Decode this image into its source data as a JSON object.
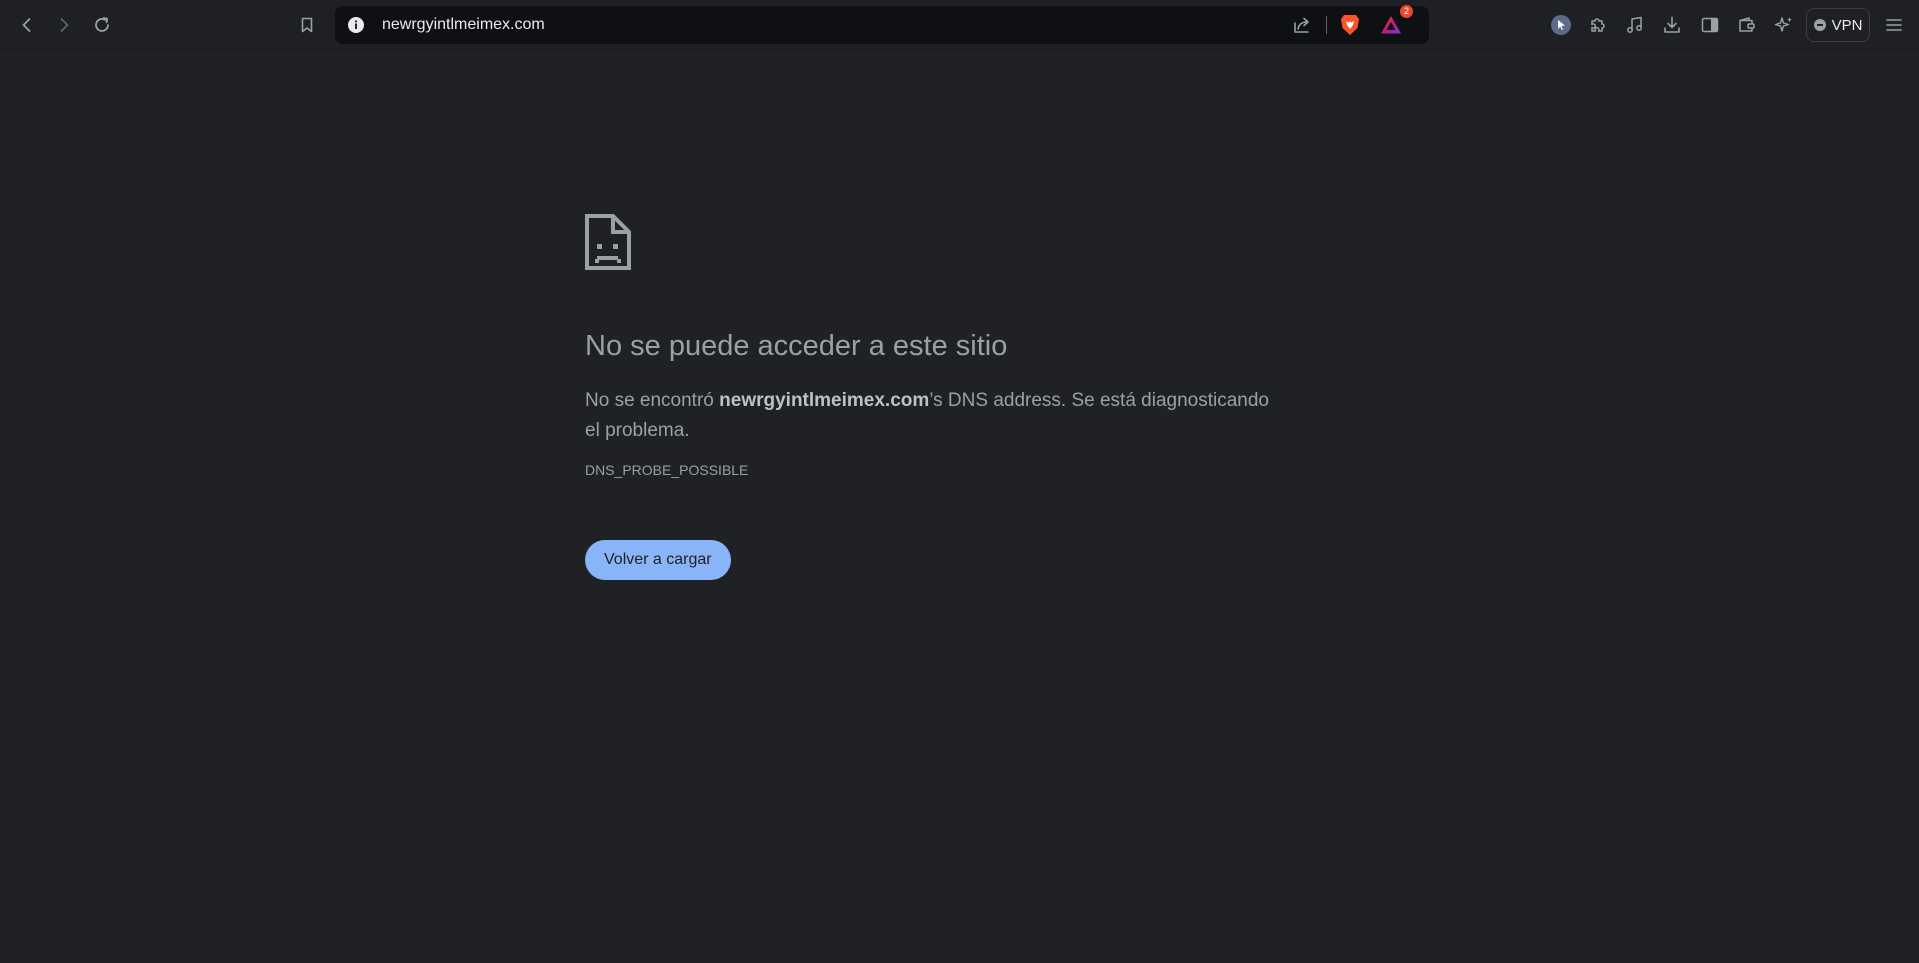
{
  "toolbar": {
    "url": "newrgyintlmeimex.com",
    "notification_count": "2",
    "vpn_label": "VPN"
  },
  "icons": {
    "back": "back-arrow-icon",
    "forward": "forward-arrow-icon",
    "reload": "reload-icon",
    "bookmark": "bookmark-icon",
    "site_info": "info-icon",
    "share": "share-icon",
    "brave_shields": "brave-lion-icon",
    "brave_rewards": "rewards-triangle-icon",
    "cursor": "cursor-icon",
    "extensions": "puzzle-icon",
    "media": "music-note-icon",
    "downloads": "download-icon",
    "sidebar": "sidebar-icon",
    "wallet": "wallet-icon",
    "leo": "sparkle-icon",
    "menu": "hamburger-menu-icon",
    "error_page": "sad-document-icon"
  },
  "error": {
    "title": "No se puede acceder a este sitio",
    "desc_prefix": "No se encontró ",
    "desc_host": "newrgyintlmeimex.com",
    "desc_suffix": "’s DNS address. Se está diagnosticando el problema.",
    "code": "DNS_PROBE_POSSIBLE",
    "reload_button": "Volver a cargar"
  },
  "colors": {
    "page_background": "#202124",
    "toolbar_background": "#1f2023",
    "urlbar_background": "#0f1013",
    "text_secondary": "#9aa0a6",
    "button_primary": "#8ab4f8",
    "badge": "#e8492d",
    "brave_orange": "#fb542b"
  }
}
